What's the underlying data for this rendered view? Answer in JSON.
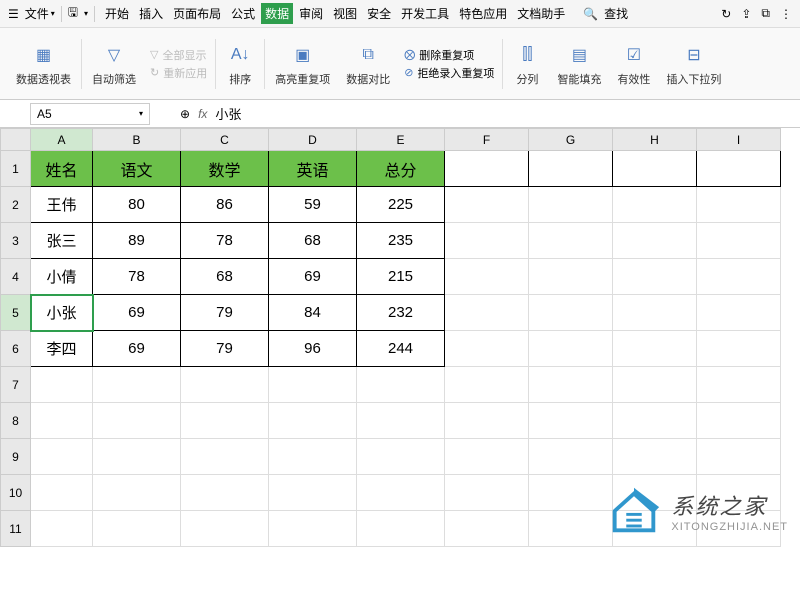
{
  "menubar": {
    "file_label": "文件",
    "tabs": [
      "开始",
      "插入",
      "页面布局",
      "公式",
      "数据",
      "审阅",
      "视图",
      "安全",
      "开发工具",
      "特色应用",
      "文档助手"
    ],
    "active_tab": "数据",
    "search_label": "查找"
  },
  "ribbon": {
    "pivot": "数据透视表",
    "autofilter": "自动筛选",
    "show_all": "全部显示",
    "reapply": "重新应用",
    "sort": "排序",
    "highlight_dup": "高亮重复项",
    "data_compare": "数据对比",
    "remove_dup": "删除重复项",
    "reject_dup": "拒绝录入重复项",
    "text_to_col": "分列",
    "smart_fill": "智能填充",
    "validation": "有效性",
    "dropdown": "插入下拉列"
  },
  "namebox": {
    "cell_ref": "A5",
    "formula_value": "小张"
  },
  "columns": [
    "A",
    "B",
    "C",
    "D",
    "E",
    "F",
    "G",
    "H",
    "I"
  ],
  "row_numbers": [
    "1",
    "2",
    "3",
    "4",
    "5",
    "6",
    "7",
    "8",
    "9",
    "10",
    "11"
  ],
  "table": {
    "headers": [
      "姓名",
      "语文",
      "数学",
      "英语",
      "总分"
    ],
    "rows": [
      {
        "name": "王伟",
        "chinese": "80",
        "math": "86",
        "english": "59",
        "total": "225"
      },
      {
        "name": "张三",
        "chinese": "89",
        "math": "78",
        "english": "68",
        "total": "235"
      },
      {
        "name": "小倩",
        "chinese": "78",
        "math": "68",
        "english": "69",
        "total": "215"
      },
      {
        "name": "小张",
        "chinese": "69",
        "math": "79",
        "english": "84",
        "total": "232"
      },
      {
        "name": "李四",
        "chinese": "69",
        "math": "79",
        "english": "96",
        "total": "244"
      }
    ]
  },
  "selected_cell": "A5",
  "watermark": {
    "title": "系统之家",
    "url": "XITONGZHIJIA.NET"
  }
}
